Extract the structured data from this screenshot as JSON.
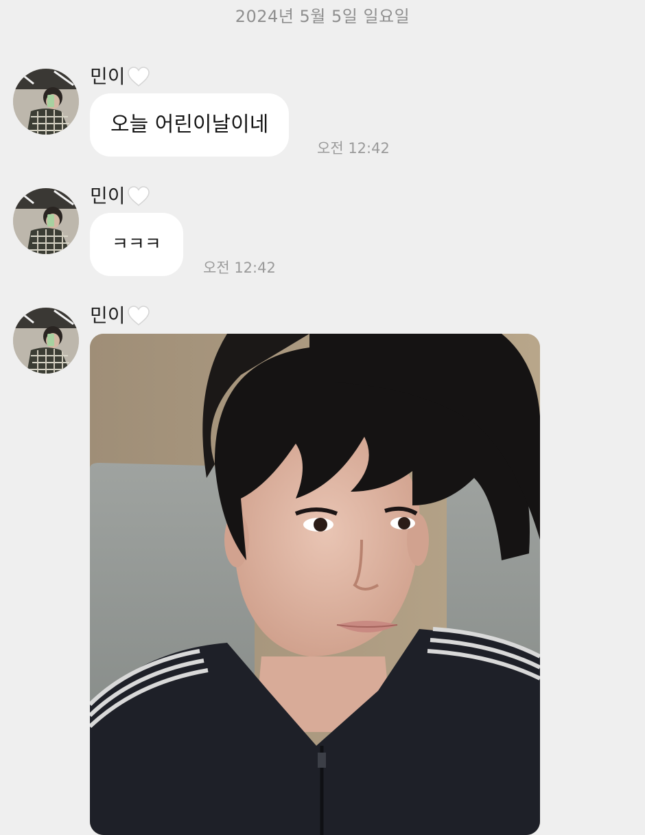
{
  "date_divider": "2024년 5월 5일 일요일",
  "messages": [
    {
      "sender": "민이",
      "heart": "white-heart-icon",
      "text": "오늘 어린이날이네",
      "time": "오전 12:42"
    },
    {
      "sender": "민이",
      "heart": "white-heart-icon",
      "text": "ㅋㅋㅋ",
      "time": "오전 12:42"
    },
    {
      "sender": "민이",
      "heart": "white-heart-icon",
      "type": "photo"
    }
  ],
  "colors": {
    "background": "#efefef",
    "bubble": "#ffffff",
    "timestamp": "#9a9a9a"
  }
}
